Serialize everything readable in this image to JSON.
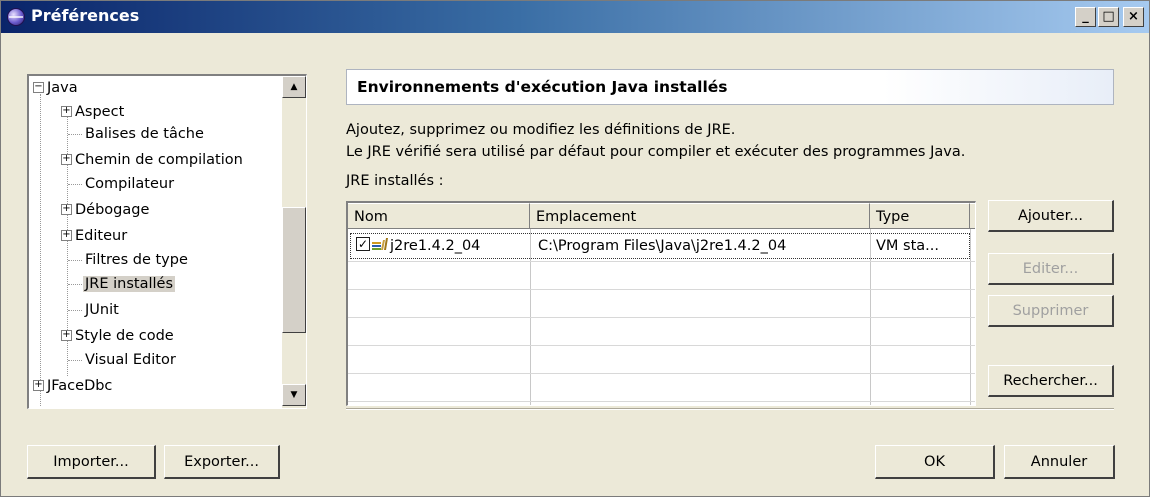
{
  "window": {
    "title": "Préférences"
  },
  "titlebar_buttons": {
    "minimize": "_",
    "maximize": "□",
    "close": "×"
  },
  "tree": {
    "items": [
      {
        "label": "Java",
        "expander": "−",
        "level": 0
      },
      {
        "label": "Aspect",
        "expander": "+",
        "level": 1
      },
      {
        "label": "Balises de tâche",
        "expander": "",
        "level": 1
      },
      {
        "label": "Chemin de compilation",
        "expander": "+",
        "level": 1
      },
      {
        "label": "Compilateur",
        "expander": "",
        "level": 1
      },
      {
        "label": "Débogage",
        "expander": "+",
        "level": 1
      },
      {
        "label": "Editeur",
        "expander": "+",
        "level": 1
      },
      {
        "label": "Filtres de type",
        "expander": "",
        "level": 1
      },
      {
        "label": "JRE installés",
        "expander": "",
        "level": 1,
        "selected": true
      },
      {
        "label": "JUnit",
        "expander": "",
        "level": 1
      },
      {
        "label": "Style de code",
        "expander": "+",
        "level": 1
      },
      {
        "label": "Visual Editor",
        "expander": "",
        "level": 1
      },
      {
        "label": "JFaceDbc",
        "expander": "+",
        "level": 0
      }
    ],
    "scroll_up": "▲",
    "scroll_down": "▼"
  },
  "page": {
    "title": "Environnements d'exécution Java installés",
    "description_line1": "Ajoutez, supprimez ou modifiez les définitions de JRE.",
    "description_line2": "Le JRE vérifié sera utilisé par défaut pour compiler et exécuter des programmes Java.",
    "jre_label": "JRE installés :"
  },
  "table": {
    "columns": [
      "Nom",
      "Emplacement",
      "Type"
    ],
    "rows": [
      {
        "checked": true,
        "check_mark": "✓",
        "name": "j2re1.4.2_04",
        "location": "C:\\Program Files\\Java\\j2re1.4.2_04",
        "type": "VM sta..."
      }
    ]
  },
  "buttons": {
    "add": "Ajouter...",
    "edit": "Editer...",
    "remove": "Supprimer",
    "search": "Rechercher...",
    "import": "Importer...",
    "export": "Exporter...",
    "ok": "OK",
    "cancel": "Annuler"
  }
}
